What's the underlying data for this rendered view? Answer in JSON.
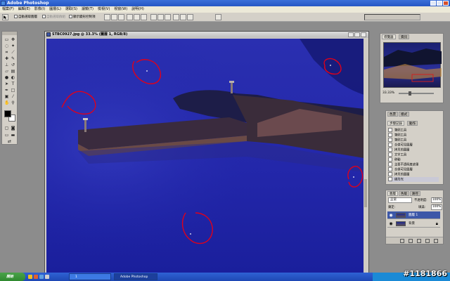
{
  "app": {
    "title": "Adobe Photoshop"
  },
  "menu": [
    "檔案(F)",
    "編輯(E)",
    "影像(I)",
    "圖層(L)",
    "選取(S)",
    "濾鏡(T)",
    "檢視(V)",
    "視窗(W)",
    "說明(H)"
  ],
  "options": {
    "auto_select": "自動選取圖層",
    "auto_select_group": "自動選取群組",
    "show_transform": "顯示變形控制項"
  },
  "document": {
    "title": "STBC0927.jpg @ 33.3% (圖層 1, RGB/8)"
  },
  "navigator": {
    "tab": "導覽器",
    "tab2": "資訊",
    "zoom": "33.33%"
  },
  "history": {
    "tab_color": "色票",
    "tab_styles": "樣式",
    "tab_history": "步驟記錄",
    "tab_actions": "動作",
    "items": [
      "筆刷工具",
      "筆刷工具",
      "筆刷工具",
      "合併可見圖層",
      "拷貝的圖層",
      "文字工具",
      "移動",
      "主要不透明度遮罩",
      "合併可見圖層",
      "拷貝的圖層",
      "線形光"
    ]
  },
  "layers": {
    "tab_layers": "圖層",
    "tab_channels": "色版",
    "tab_paths": "路徑",
    "blend_mode": "正常",
    "opacity_label": "不透明度:",
    "opacity_value": "100%",
    "lock_label": "鎖定:",
    "fill_label": "填滿:",
    "fill_value": "100%",
    "items": [
      {
        "name": "圖層 1",
        "selected": true
      },
      {
        "name": "背景",
        "selected": false
      }
    ]
  },
  "taskbar": {
    "start": "開始",
    "items": [
      "1",
      "Adobe Photoshop"
    ]
  },
  "watermark": "#1181866",
  "colors": {
    "accent": "#2456c4",
    "panel": "#d4d0c8",
    "annotation": "#e0001a",
    "sea": "#1d23a8"
  }
}
